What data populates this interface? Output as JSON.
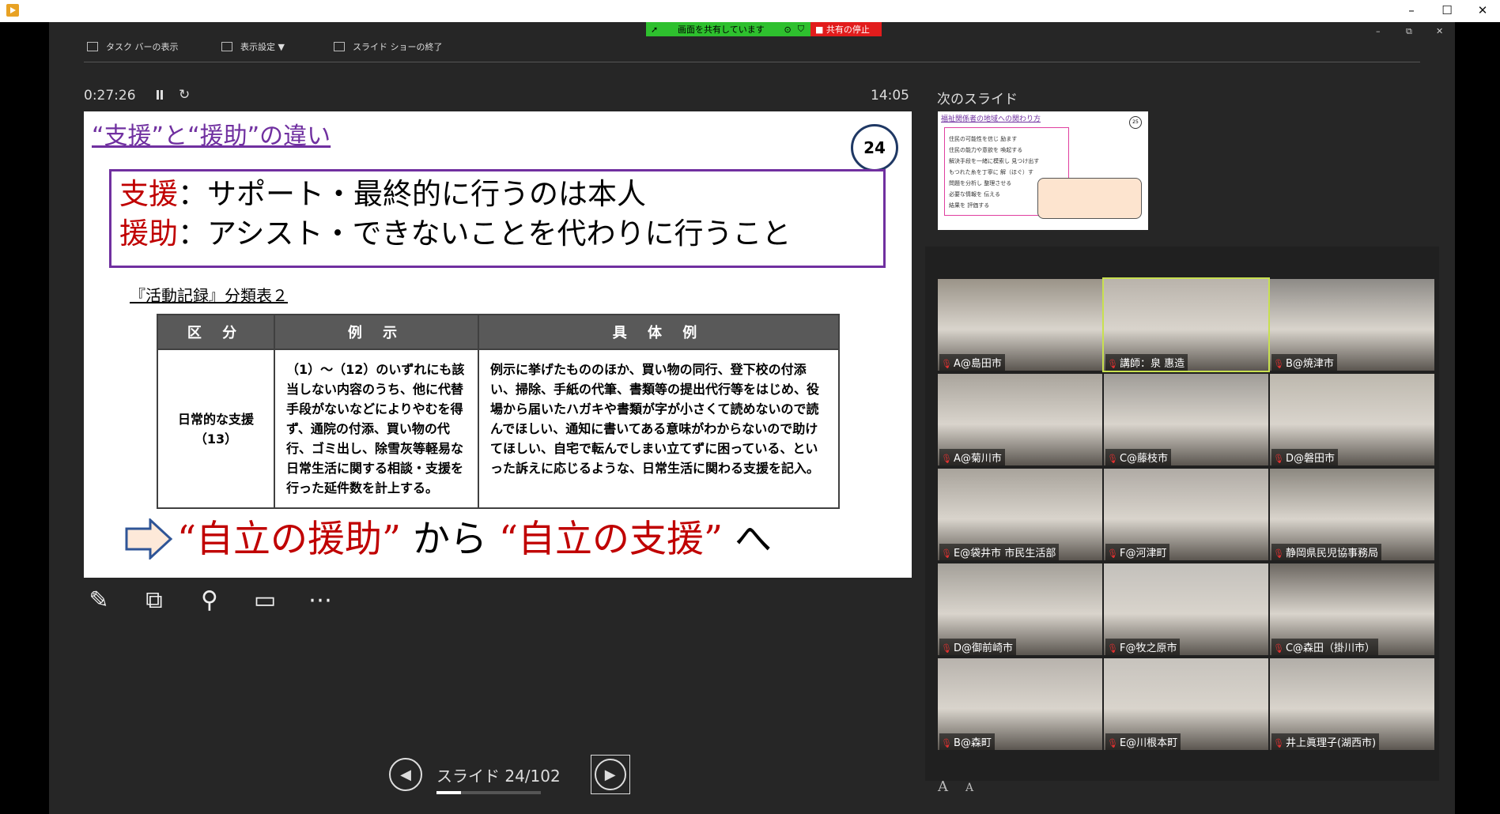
{
  "window": {
    "minimize": "–",
    "maximize": "☐",
    "close": "✕"
  },
  "share": {
    "status": "画面を共有しています",
    "stop": "■ 共有の停止"
  },
  "toolbar": {
    "taskbar": "タスク バーの表示",
    "display": "表示設定 ▼",
    "end": "スライド ショーの終了"
  },
  "pres_window": {
    "minimize": "–",
    "restore": "⧉",
    "close": "✕"
  },
  "presenter": {
    "elapsed": "0:27:26",
    "clock": "14:05",
    "next_label": "次のスライド"
  },
  "slide": {
    "title": "“支援”と“援助”の違い",
    "number": "24",
    "line1_red": "支援",
    "line1_rest": "：サポート・最終的に行うのは本人",
    "line2_red": "援助",
    "line2_rest": "：アシスト・できないことを代わりに行うこと",
    "subtitle": "『活動記録』分類表２",
    "table": {
      "headers": [
        "区 分",
        "例 示",
        "具 体 例"
      ],
      "cat": "日常的な支援\n（13）",
      "example": "（1）～（12）のいずれにも該当しない内容のうち、他に代替手段がないなどによりやむを得ず、通院の付添、買い物の代行、ゴミ出し、除雪灰等軽易な日常生活に関する相談・支援を行った延件数を計上する。",
      "detail": "例示に挙げたもののほか、買い物の同行、登下校の付添い、掃除、手紙の代筆、書類等の提出代行等をはじめ、役場から届いたハガキや書類が字が小さくて読めないので読んでほしい、通知に書いてある意味がわからないので助けてほしい、自宅で転んでしまい立てずに困っている、といった訴えに応じるような、日常生活に関わる支援を記入。"
    },
    "bottom_red1": "“自立の援助”",
    "bottom_mid": "から",
    "bottom_red2": "“自立の支援”",
    "bottom_end": "へ"
  },
  "next_slide": {
    "title": "福祉関係者の地域への関わり方",
    "number": "25",
    "rows": [
      "住民の可能性を信じ 励ます",
      "住民の能力や意欲を 喚起する",
      "解決手段を一緒に模索し 見つけ出す",
      "もつれた糸を丁寧に 解（ほぐ）す",
      "問題を分析し 整理させる",
      "必要な情報を 伝える",
      "結果を 評価する"
    ]
  },
  "nav": {
    "slide_label": "スライド 24/102",
    "progress": 0.235
  },
  "participants": [
    {
      "name": "A@島田市",
      "active": false
    },
    {
      "name": "講師：泉 惠造",
      "active": true
    },
    {
      "name": "B@焼津市",
      "active": false
    },
    {
      "name": "A@菊川市",
      "active": false
    },
    {
      "name": "C@藤枝市",
      "active": false
    },
    {
      "name": "D@磐田市",
      "active": false
    },
    {
      "name": "E@袋井市 市民生活部",
      "active": false
    },
    {
      "name": "F@河津町",
      "active": false
    },
    {
      "name": "静岡県民児協事務局",
      "active": false
    },
    {
      "name": "D@御前崎市",
      "active": false
    },
    {
      "name": "F@牧之原市",
      "active": false
    },
    {
      "name": "C@森田（掛川市）",
      "active": false
    },
    {
      "name": "B@森町",
      "active": false
    },
    {
      "name": "E@川根本町",
      "active": false
    },
    {
      "name": "井上眞理子(湖西市)",
      "active": false
    }
  ],
  "fontsize": {
    "larger": "A",
    "smaller": "A"
  },
  "colors": {
    "accent_purple": "#7030a0",
    "accent_red": "#c00000",
    "share_green": "#2ec02e",
    "share_red": "#e21c1c"
  }
}
